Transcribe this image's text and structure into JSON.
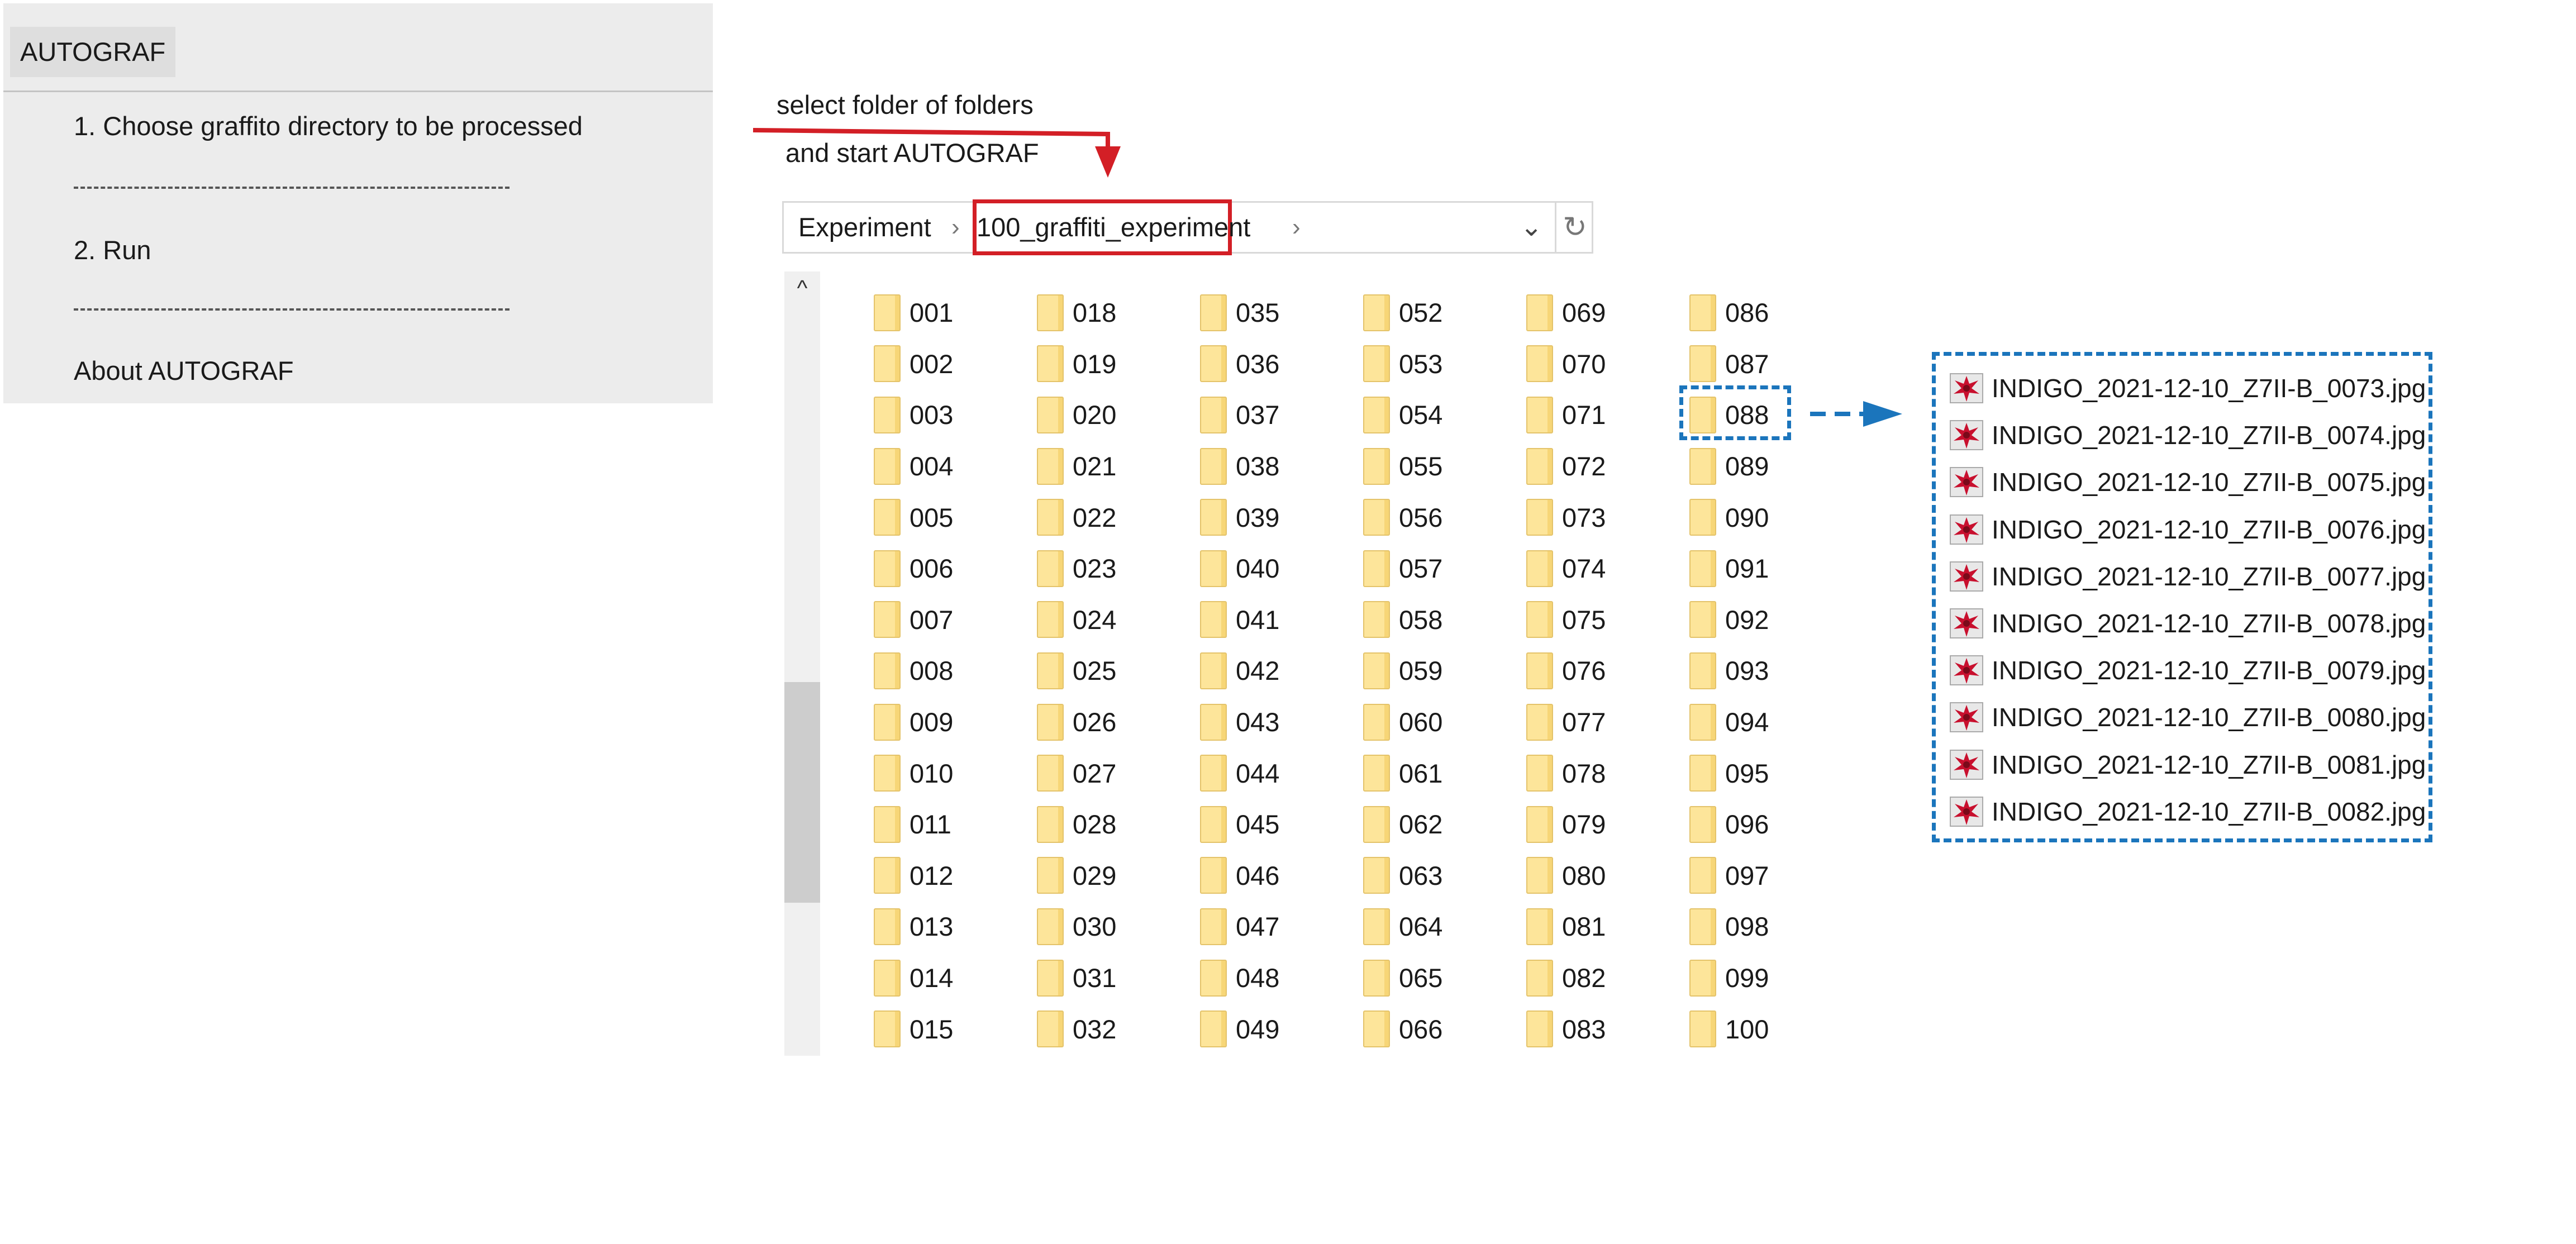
{
  "menu": {
    "title": "AUTOGRAF",
    "item1": "1. Choose graffito directory to be processed",
    "item2": "2. Run",
    "item3": "About AUTOGRAF"
  },
  "annotation": {
    "line1": "select folder of folders",
    "line2": "and start AUTOGRAF"
  },
  "address_bar": {
    "parent": "Experiment",
    "current": "100_graffiti_experiment",
    "separator": "›",
    "chevron": "⌄",
    "refresh": "↻"
  },
  "scroll_up_symbol": "^",
  "folders": [
    "001",
    "002",
    "003",
    "004",
    "005",
    "006",
    "007",
    "008",
    "009",
    "010",
    "011",
    "012",
    "013",
    "014",
    "015",
    "018",
    "019",
    "020",
    "021",
    "022",
    "023",
    "024",
    "025",
    "026",
    "027",
    "028",
    "029",
    "030",
    "031",
    "032",
    "035",
    "036",
    "037",
    "038",
    "039",
    "040",
    "041",
    "042",
    "043",
    "044",
    "045",
    "046",
    "047",
    "048",
    "049",
    "052",
    "053",
    "054",
    "055",
    "056",
    "057",
    "058",
    "059",
    "060",
    "061",
    "062",
    "063",
    "064",
    "065",
    "066",
    "069",
    "070",
    "071",
    "072",
    "073",
    "074",
    "075",
    "076",
    "077",
    "078",
    "079",
    "080",
    "081",
    "082",
    "083",
    "086",
    "087",
    "088",
    "089",
    "090",
    "091",
    "092",
    "093",
    "094",
    "095",
    "096",
    "097",
    "098",
    "099",
    "100"
  ],
  "highlighted_folder": "088",
  "files": [
    "INDIGO_2021-12-10_Z7II-B_0073.jpg",
    "INDIGO_2021-12-10_Z7II-B_0074.jpg",
    "INDIGO_2021-12-10_Z7II-B_0075.jpg",
    "INDIGO_2021-12-10_Z7II-B_0076.jpg",
    "INDIGO_2021-12-10_Z7II-B_0077.jpg",
    "INDIGO_2021-12-10_Z7II-B_0078.jpg",
    "INDIGO_2021-12-10_Z7II-B_0079.jpg",
    "INDIGO_2021-12-10_Z7II-B_0080.jpg",
    "INDIGO_2021-12-10_Z7II-B_0081.jpg",
    "INDIGO_2021-12-10_Z7II-B_0082.jpg"
  ],
  "colors": {
    "annotation_red": "#d31f26",
    "annotation_blue": "#1b75bc",
    "folder_yellow": "#fde59a",
    "menu_bg": "#ececec"
  }
}
